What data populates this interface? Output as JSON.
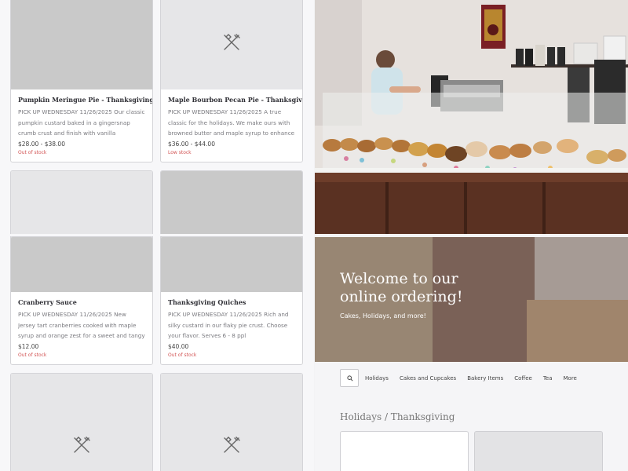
{
  "products": [
    {
      "title": "Pumpkin Meringue Pie - Thanksgiving",
      "description": "PICK UP WEDNESDAY 11/26/2025 Our classic pumpkin custard baked in a gingersnap crumb crust and finish with vanilla meringue. Small…",
      "price": "$28.00 - $38.00",
      "stock": "Out of stock"
    },
    {
      "title": "Maple Bourbon Pecan Pie - Thanksgiving",
      "description": "PICK UP WEDNESDAY 11/26/2025 A true classic for the holidays. We make ours with browned butter and maple syrup to enhance the…",
      "price": "$36.00 - $44.00",
      "stock": "Low stock"
    },
    {
      "title": "Cranberry Sauce",
      "description": "PICK UP WEDNESDAY 11/26/2025 New Jersey tart cranberries cooked with maple syrup and orange zest for a sweet and tangy side you'll…",
      "price": "$12.00",
      "stock": "Out of stock"
    },
    {
      "title": "Thanksgiving Quiches",
      "description": "PICK UP WEDNESDAY 11/26/2025 Rich and silky custard in our flaky pie crust. Choose your flavor. Serves 6 - 8 ppl",
      "price": "$40.00",
      "stock": "Out of stock"
    }
  ],
  "banner": {
    "title": "Welcome to our online ordering!",
    "subtitle": "Cakes, Holidays, and more!"
  },
  "nav": {
    "search_icon": "search-icon",
    "items": [
      "Holidays",
      "Cakes and Cupcakes",
      "Bakery Items",
      "Coffee",
      "Tea",
      "More"
    ]
  },
  "breadcrumb": "Holidays / Thanksgiving",
  "colors": {
    "out_of_stock": "#d25454",
    "placeholder_dark": "#c9c9c9",
    "placeholder_light": "#e6e6e8",
    "page_bg": "#f7f7f9"
  },
  "icons": {
    "product_placeholder": "utensils-icon"
  }
}
